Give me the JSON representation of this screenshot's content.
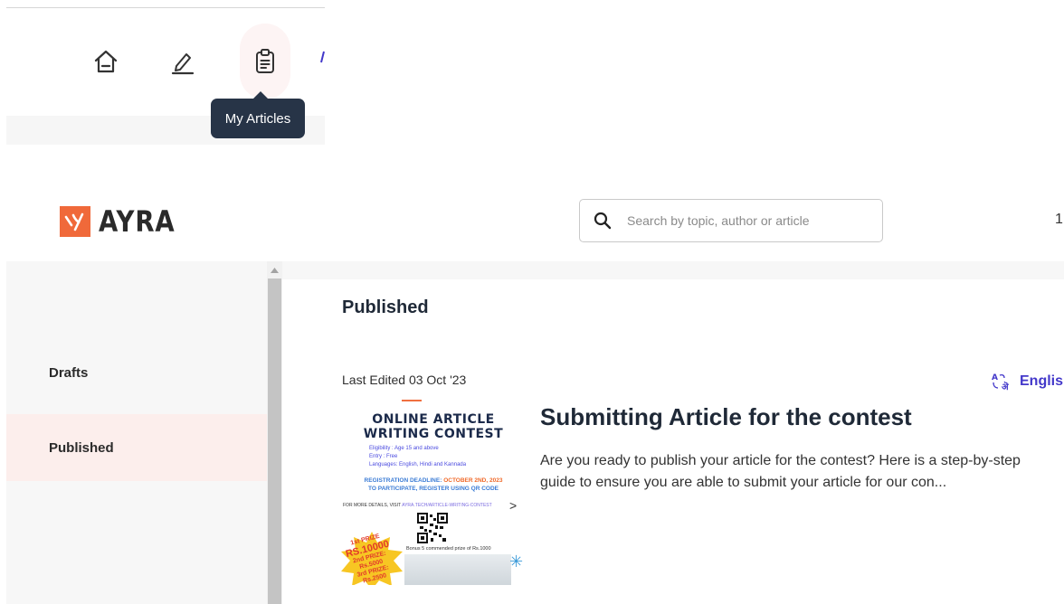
{
  "toolbar": {
    "icons": [
      "home-icon",
      "edit-pen-icon",
      "clipboard-articles-icon"
    ],
    "tooltip": "My Articles"
  },
  "header": {
    "brand": "AYRA",
    "search_placeholder": "Search by topic, author or article",
    "cut_text": "1"
  },
  "sidebar": {
    "items": [
      {
        "label": "Drafts",
        "active": false
      },
      {
        "label": "Published",
        "active": true
      }
    ]
  },
  "main": {
    "section_title": "Published",
    "last_edited": "Last Edited 03 Oct '23",
    "language": "English",
    "article": {
      "title": "Submitting Article for the contest",
      "description": "Are you ready to publish your article for the contest?  Here is a step-by-step guide to ensure you are able to submit your article for our con...",
      "thumbnail": {
        "heading_line1": "ONLINE ARTICLE",
        "heading_line2": "WRITING CONTEST",
        "eligibility": "Eligibility  : Age 15 and above",
        "entry": "Entry        : Free",
        "languages": "Languages: English, Hindi and Kannada",
        "deadline_label": "REGISTRATION DEADLINE:",
        "deadline_value": "OCTOBER 2ND, 2023",
        "register": "TO PARTICIPATE, REGISTER USING QR CODE",
        "details_prefix": "FOR MORE DETAILS, VISIT",
        "details_link": "AYRA.TECH/ARTICLE-WRITING-CONTEST",
        "first_prize_label": "1st PRIZE",
        "first_prize_amount": "RS.10000",
        "second_prize": "2nd PRIZE: Rs.5000",
        "third_prize": "3rd PRIZE: Rs.2500",
        "bonus": "Bonus 5 commended prize of Rs.1000"
      }
    }
  },
  "colors": {
    "brand_orange": "#f0693a",
    "accent_indigo": "#4338ca",
    "tooltip_bg": "#273447",
    "active_item_bg": "#fceeec"
  }
}
